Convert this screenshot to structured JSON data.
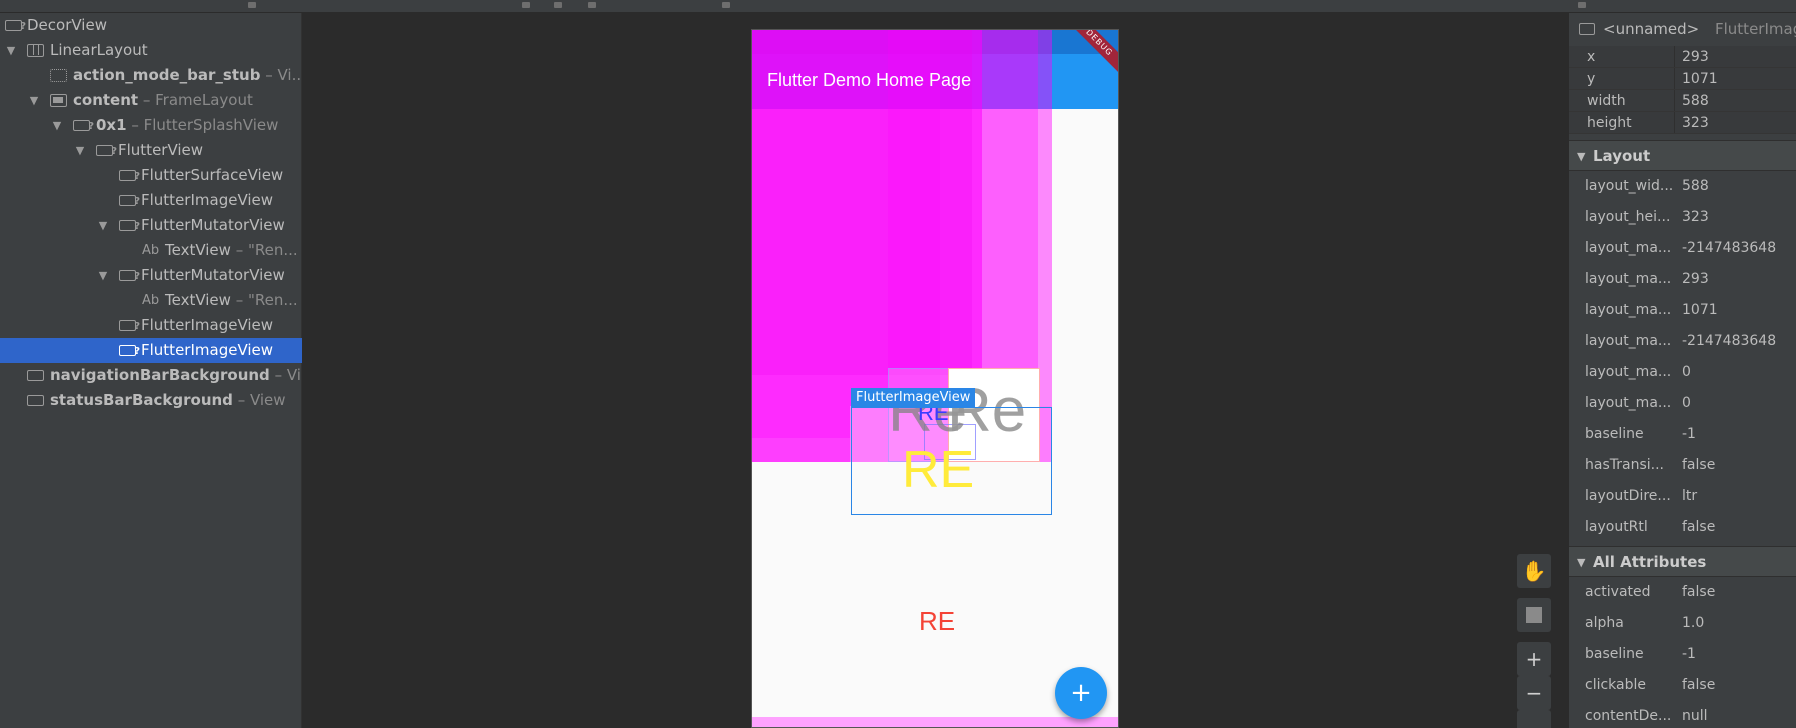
{
  "tree": {
    "items": [
      {
        "label": "DecorView",
        "sub": ""
      },
      {
        "label": "LinearLayout",
        "sub": ""
      },
      {
        "label": "action_mode_bar_stub",
        "sub": " – Vi..."
      },
      {
        "label": "content",
        "sub": " – FrameLayout"
      },
      {
        "label": "0x1",
        "sub": " – FlutterSplashView"
      },
      {
        "label": "FlutterView",
        "sub": ""
      },
      {
        "label": "FlutterSurfaceView",
        "sub": ""
      },
      {
        "label": "FlutterImageView",
        "sub": ""
      },
      {
        "label": "FlutterMutatorView",
        "sub": ""
      },
      {
        "label": "TextView",
        "sub": " – \"Ren..."
      },
      {
        "label": "FlutterMutatorView",
        "sub": ""
      },
      {
        "label": "TextView",
        "sub": " – \"Ren..."
      },
      {
        "label": "FlutterImageView",
        "sub": ""
      },
      {
        "label": "FlutterImageView",
        "sub": ""
      },
      {
        "label": "navigationBarBackground",
        "sub": " – Vi..."
      },
      {
        "label": "statusBarBackground",
        "sub": " – View"
      }
    ],
    "ab": "Ab"
  },
  "preview": {
    "app_title": "Flutter Demo Home Page",
    "debug_banner": "DEBUG",
    "selected_tag": "FlutterImageView",
    "re_grey_left": "Re",
    "re_grey_right": "Re",
    "re_blue": "RE",
    "re_yellow": "RE",
    "re_red": "RE",
    "fab_symbol": "+"
  },
  "tools": {
    "pan": "✋",
    "zoom_in": "+",
    "zoom_out": "−"
  },
  "props": {
    "header_name": "<unnamed>",
    "header_type": "FlutterImag",
    "basic": [
      {
        "k": "x",
        "v": "293"
      },
      {
        "k": "y",
        "v": "1071"
      },
      {
        "k": "width",
        "v": "588"
      },
      {
        "k": "height",
        "v": "323"
      }
    ],
    "layout_title": "Layout",
    "layout": [
      {
        "k": "layout_wid...",
        "v": "588"
      },
      {
        "k": "layout_hei...",
        "v": "323"
      },
      {
        "k": "layout_ma...",
        "v": "-2147483648"
      },
      {
        "k": "layout_ma...",
        "v": "293"
      },
      {
        "k": "layout_ma...",
        "v": "1071"
      },
      {
        "k": "layout_ma...",
        "v": "-2147483648"
      },
      {
        "k": "layout_ma...",
        "v": "0"
      },
      {
        "k": "layout_ma...",
        "v": "0"
      },
      {
        "k": "baseline",
        "v": "-1"
      },
      {
        "k": "hasTransi...",
        "v": "false"
      },
      {
        "k": "layoutDire...",
        "v": "ltr"
      },
      {
        "k": "layoutRtl",
        "v": "false"
      }
    ],
    "all_title": "All Attributes",
    "all": [
      {
        "k": "activated",
        "v": "false"
      },
      {
        "k": "alpha",
        "v": "1.0"
      },
      {
        "k": "baseline",
        "v": "-1"
      },
      {
        "k": "clickable",
        "v": "false"
      },
      {
        "k": "contentDe...",
        "v": "null"
      }
    ]
  }
}
